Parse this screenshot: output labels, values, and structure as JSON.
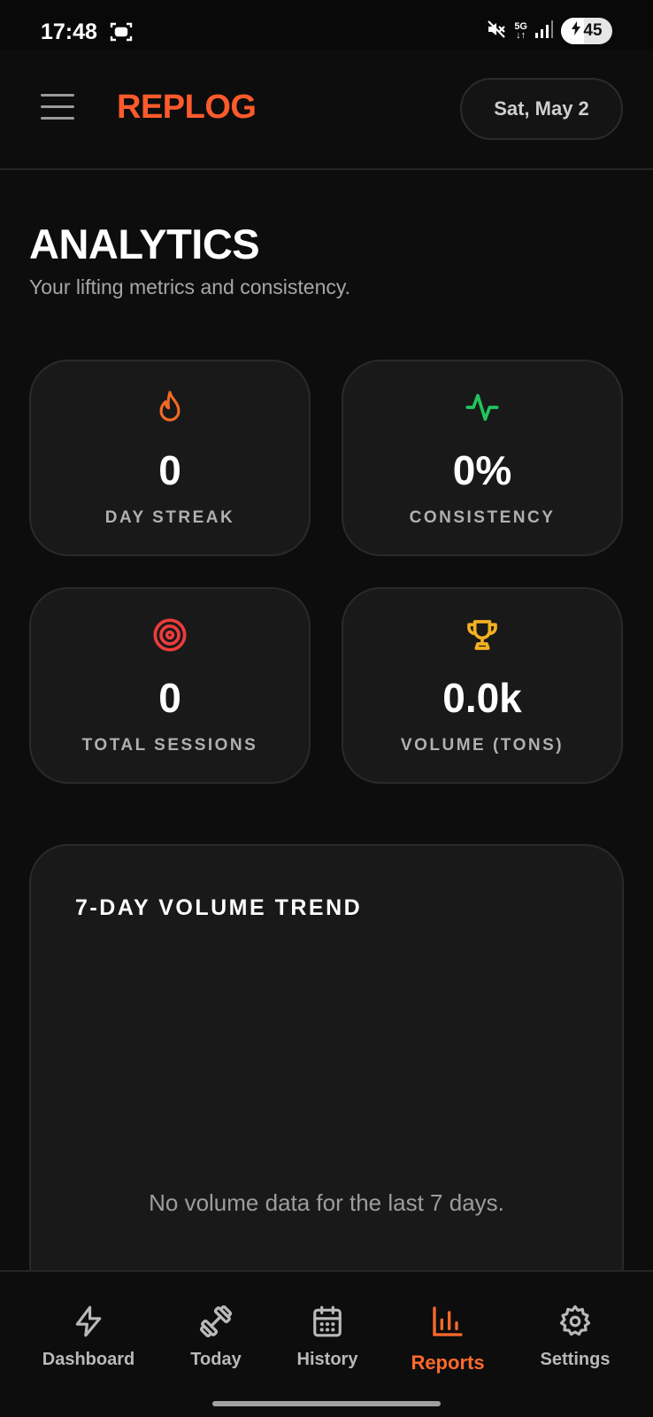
{
  "status_bar": {
    "time": "17:48",
    "network": "5G",
    "battery_level": "45",
    "battery_fraction": 0.45
  },
  "header": {
    "brand": "REPLOG",
    "date": "Sat, May 2"
  },
  "page": {
    "title": "ANALYTICS",
    "subtitle": "Your lifting metrics and consistency."
  },
  "stats": [
    {
      "value": "0",
      "label": "DAY STREAK",
      "icon": "flame-icon",
      "color": "#f26b22"
    },
    {
      "value": "0%",
      "label": "CONSISTENCY",
      "icon": "activity-icon",
      "color": "#22c35e"
    },
    {
      "value": "0",
      "label": "TOTAL SESSIONS",
      "icon": "target-icon",
      "color": "#ef3b3b"
    },
    {
      "value": "0.0k",
      "label": "VOLUME (TONS)",
      "icon": "trophy-icon",
      "color": "#f2b021"
    }
  ],
  "trend": {
    "title": "7-DAY VOLUME TREND",
    "empty_message": "No volume data for the last 7 days."
  },
  "nav": {
    "active": "Reports",
    "accent": "#ff6a2c",
    "items": [
      {
        "label": "Dashboard",
        "icon": "zap-icon"
      },
      {
        "label": "Today",
        "icon": "dumbbell-icon"
      },
      {
        "label": "History",
        "icon": "calendar-icon"
      },
      {
        "label": "Reports",
        "icon": "bar-chart-icon"
      },
      {
        "label": "Settings",
        "icon": "gear-icon"
      }
    ]
  }
}
